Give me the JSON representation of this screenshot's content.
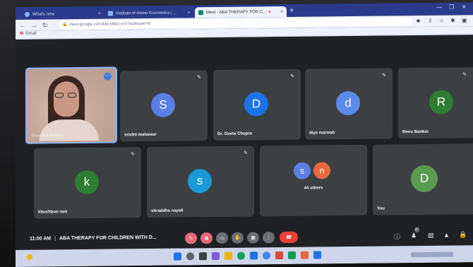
{
  "browser": {
    "tabs": [
      {
        "title": "What's new",
        "active": false,
        "icon_color": "#8ab4f8"
      },
      {
        "title": "Institute of Home Economics | ...",
        "active": false,
        "icon_color": "#8ab4f8"
      },
      {
        "title": "Meet - ABA THERAPY FOR C...",
        "active": true,
        "icon_color": "#00897b"
      }
    ],
    "new_tab": "+",
    "url": "meet.google.com/kbi-bhbu-vcs?authuser=0",
    "bookmark": "Gmail"
  },
  "tiles": [
    {
      "kind": "self-video",
      "name": "Shradha Mathur"
    },
    {
      "kind": "avatar",
      "letter": "S",
      "name": "srishti mahawar",
      "color": "#5b7ee5"
    },
    {
      "kind": "avatar",
      "letter": "D",
      "name": "Dr. Geeta Chopra",
      "color": "#1a73e8"
    },
    {
      "kind": "avatar",
      "letter": "d",
      "name": "diya marwah",
      "color": "#5b8be8"
    },
    {
      "kind": "avatar",
      "letter": "R",
      "name": "Renu Bankar",
      "color": "#2e7d32"
    },
    {
      "kind": "avatar",
      "letter": "k",
      "name": "khushboo rani",
      "color": "#2e7d32"
    },
    {
      "kind": "avatar",
      "letter": "s",
      "name": "shraddha nayak",
      "color": "#1a9bd8"
    },
    {
      "kind": "others",
      "letters": [
        "s",
        "n"
      ],
      "colors": [
        "#5b7ee5",
        "#e8693f"
      ],
      "name": "44 others"
    },
    {
      "kind": "avatar",
      "letter": "D",
      "name": "You",
      "color": "#5c9a50"
    }
  ],
  "meeting": {
    "time": "11:00 AM",
    "title": "ABA THERAPY FOR CHILDREN WITH D..."
  },
  "participants_badge": "47",
  "colors": {
    "tab_bar": "#2b3a8a",
    "tile_bg": "#3c4043",
    "hangup": "#ea4335"
  }
}
